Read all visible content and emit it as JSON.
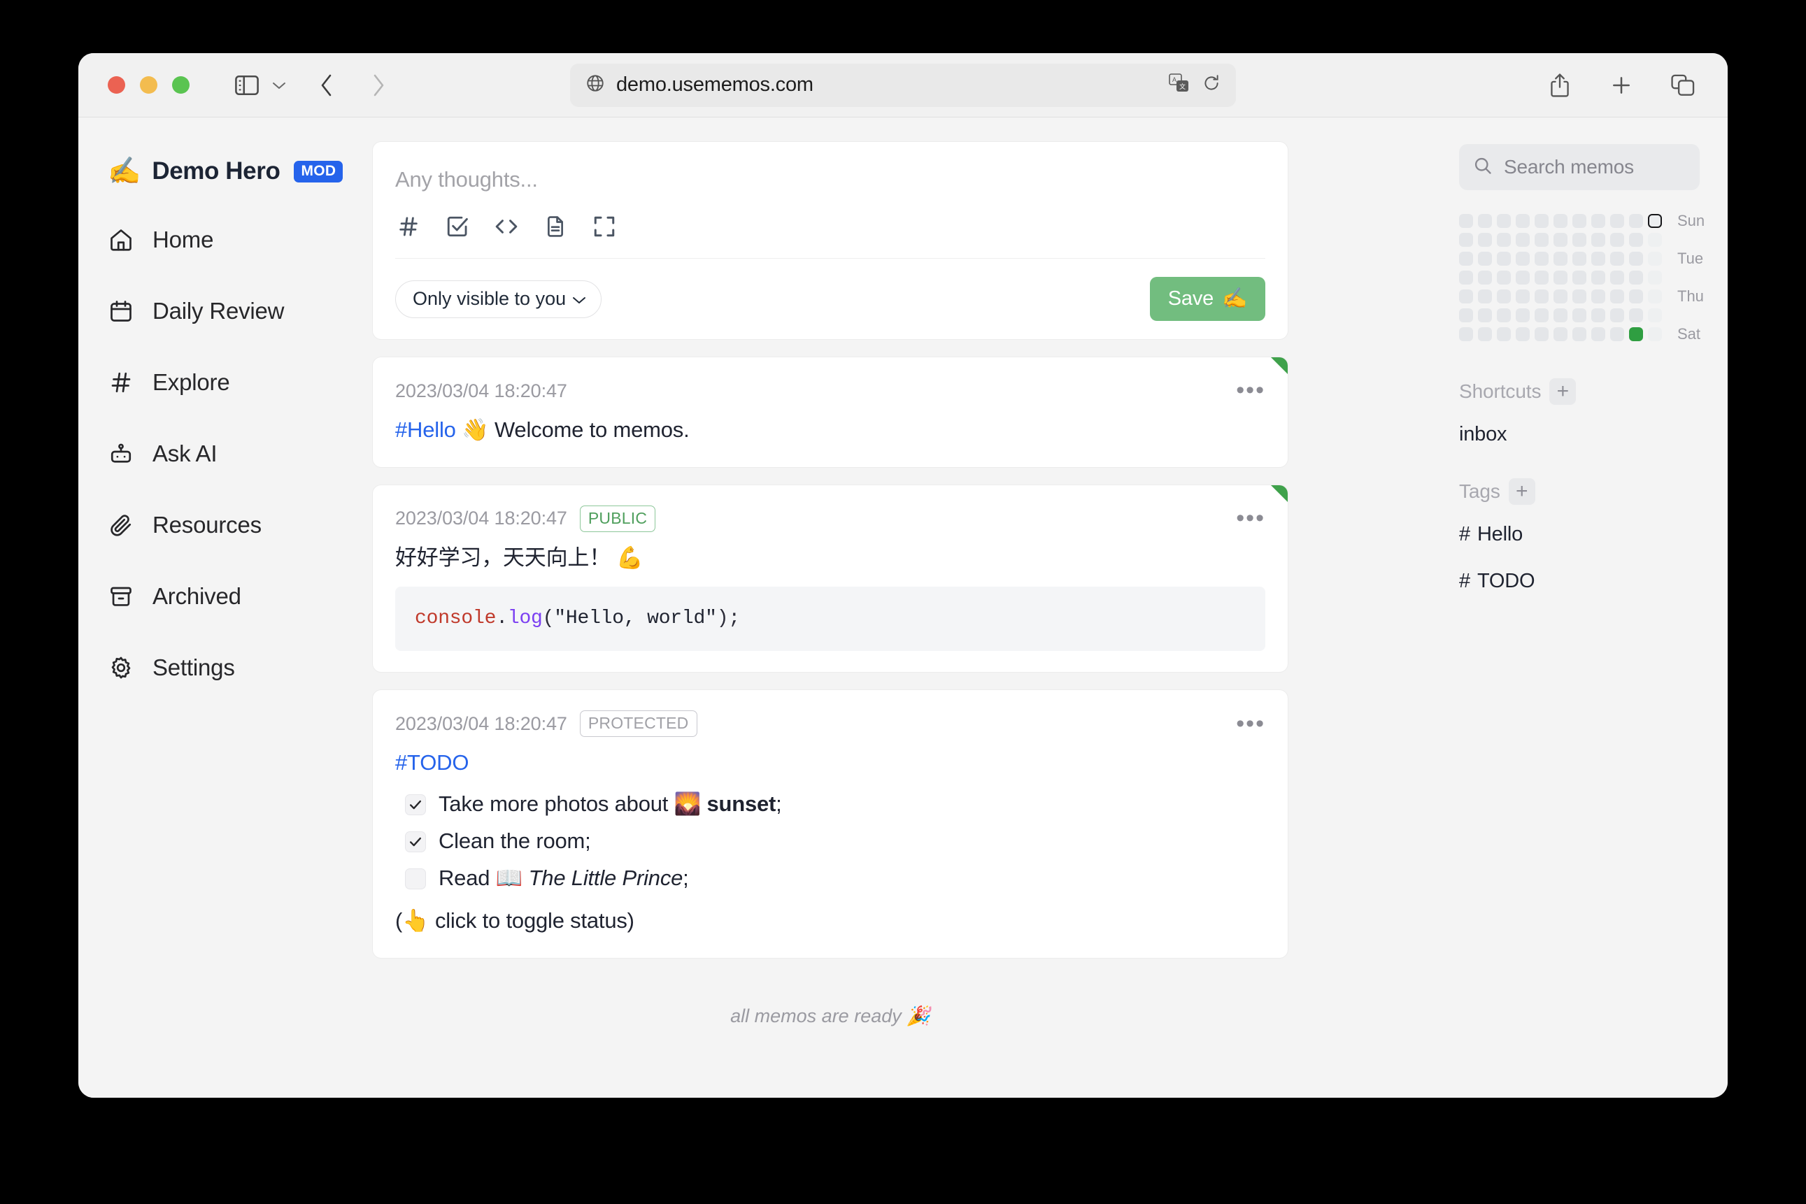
{
  "browser": {
    "url": "demo.usememos.com",
    "icons": {
      "globe": "globe-icon",
      "translate": "translate-icon",
      "reload": "reload-icon",
      "sidebar": "sidebar-toggle-icon",
      "chevron": "chevron-down-icon",
      "back": "back-arrow-icon",
      "forward": "forward-arrow-icon",
      "share": "share-icon",
      "newtab": "plus-icon",
      "tabs": "tab-overview-icon"
    }
  },
  "sidebar": {
    "brand": {
      "emoji": "✍️",
      "name": "Demo Hero",
      "badge": "MOD"
    },
    "items": [
      {
        "label": "Home",
        "icon": "home-icon"
      },
      {
        "label": "Daily Review",
        "icon": "calendar-icon"
      },
      {
        "label": "Explore",
        "icon": "hash-icon"
      },
      {
        "label": "Ask AI",
        "icon": "robot-icon"
      },
      {
        "label": "Resources",
        "icon": "paperclip-icon"
      },
      {
        "label": "Archived",
        "icon": "archive-icon"
      },
      {
        "label": "Settings",
        "icon": "gear-icon"
      }
    ]
  },
  "editor": {
    "placeholder": "Any thoughts...",
    "tools": [
      {
        "name": "tag-icon"
      },
      {
        "name": "checkbox-icon"
      },
      {
        "name": "code-icon"
      },
      {
        "name": "document-icon"
      },
      {
        "name": "fullscreen-icon"
      }
    ],
    "visibility": "Only visible to you",
    "save_label": "Save",
    "save_emoji": "✍️"
  },
  "memos": [
    {
      "time": "2023/03/04 18:20:47",
      "visibility": null,
      "pinned": true,
      "tag": "#Hello",
      "emoji": "👋",
      "text": "Welcome to memos."
    },
    {
      "time": "2023/03/04 18:20:47",
      "visibility": "PUBLIC",
      "pinned": true,
      "text": "好好学习，天天向上！",
      "emoji": "💪",
      "code": {
        "obj": "console",
        "dot": ".",
        "fn": "log",
        "open": "(",
        "str": "\"Hello, world\"",
        "close": ");"
      }
    },
    {
      "time": "2023/03/04 18:20:47",
      "visibility": "PROTECTED",
      "pinned": false,
      "tag": "#TODO",
      "todos": [
        {
          "checked": true,
          "pre": "Take more photos about ",
          "emoji": "🌄",
          "bold": "sunset",
          "post": ";"
        },
        {
          "checked": true,
          "pre": "Clean the room;",
          "emoji": "",
          "bold": "",
          "post": ""
        },
        {
          "checked": false,
          "pre": "Read ",
          "emoji": "📖",
          "italic": "The Little Prince",
          "post": ";"
        }
      ],
      "note_prefix": "(",
      "note_emoji": "👆",
      "note": " click to toggle status)"
    }
  ],
  "feed_end": "all memos are ready 🎉",
  "right": {
    "search_placeholder": "Search memos",
    "heatmap": {
      "day_labels": [
        "Sun",
        "Tue",
        "Thu",
        "Sat"
      ],
      "columns": 11,
      "rows": 7,
      "today_cell": {
        "row": 0,
        "col": 10
      },
      "active_cells": [
        {
          "row": 6,
          "col": 9,
          "level": 1
        }
      ]
    },
    "shortcuts": {
      "title": "Shortcuts",
      "add": "+",
      "items": [
        "inbox"
      ]
    },
    "tags": {
      "title": "Tags",
      "add": "+",
      "items": [
        "Hello",
        "TODO"
      ]
    }
  },
  "colors": {
    "accent_green": "#72bd7f",
    "pin_green": "#3fa14b",
    "link_blue": "#2563eb",
    "badge_blue": "#2563eb",
    "heat_green": "#2f9e41"
  }
}
